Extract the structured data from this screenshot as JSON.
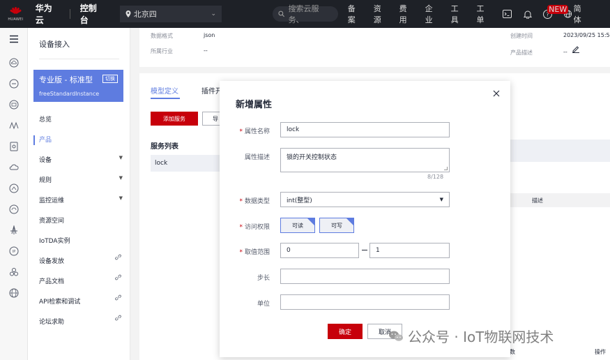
{
  "topbar": {
    "logo_text": "HUAWEI",
    "brand": "华为云",
    "console": "控制台",
    "region": "北京四",
    "search_placeholder": "搜索云服务、",
    "links": [
      "备案",
      "资源",
      "费用",
      "企业",
      "工具",
      "工单"
    ],
    "new_badge": "NEW",
    "language": "简体"
  },
  "sidebar": {
    "title": "设备接入",
    "edition": {
      "name": "专业版 - 标准型",
      "switch_label": "切换",
      "instance": "freeStandardInstance"
    },
    "items": [
      {
        "label": "总览"
      },
      {
        "label": "产品"
      },
      {
        "label": "设备"
      },
      {
        "label": "规则"
      },
      {
        "label": "监控运维"
      },
      {
        "label": "资源空间"
      },
      {
        "label": "IoTDA实例"
      },
      {
        "label": "设备发放"
      },
      {
        "label": "产品文档"
      },
      {
        "label": "API检索和调试"
      },
      {
        "label": "论坛求助"
      }
    ]
  },
  "background": {
    "data_format_label": "数据格式",
    "data_format_value": "json",
    "industry_label": "所属行业",
    "industry_value": "--",
    "created_label": "创建时间",
    "created_value": "2023/09/25 15:5",
    "desc_label": "产品描述",
    "desc_value": "--",
    "tab_model": "模型定义",
    "tab_plugin": "插件开",
    "add_service": "添加服务",
    "import": "导",
    "service_list": "服务列表",
    "service_lock": "lock",
    "col_desc": "描述",
    "col_num": "数",
    "col_ops": "操作"
  },
  "dialog": {
    "title": "新增属性",
    "name_label": "属性名称",
    "name_value": "lock",
    "desc_label": "属性描述",
    "desc_value": "锁的开关控制状态",
    "desc_count": "8/128",
    "type_label": "数据类型",
    "type_value": "int(整型)",
    "access_label": "访问权限",
    "access_read": "可读",
    "access_write": "可写",
    "range_label": "取值范围",
    "range_min": "0",
    "range_max": "1",
    "step_label": "步长",
    "step_value": "",
    "unit_label": "单位",
    "unit_value": "",
    "ok": "确定",
    "cancel": "取消"
  },
  "watermark": "公众号 · IoT物联网技术",
  "colors": {
    "accent": "#5e7ce0",
    "brand_red": "#c7000b",
    "topbar": "#1e2127"
  }
}
